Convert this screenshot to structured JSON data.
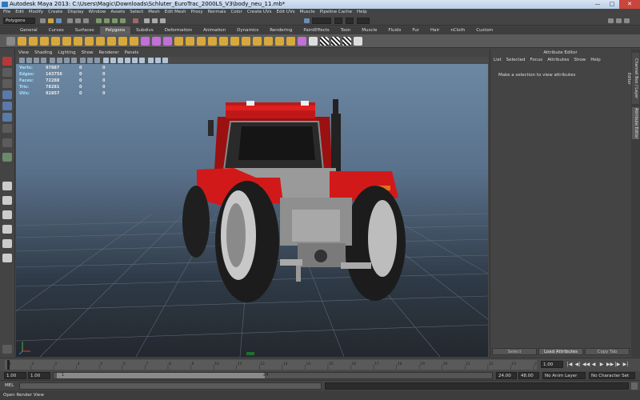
{
  "window": {
    "title": "Autodesk Maya 2013: C:\\Users\\Magic\\Downloads\\Schluter_EuroTrac_2000LS_V3\\body_neu_11.mb*"
  },
  "menubar": [
    "File",
    "Edit",
    "Modify",
    "Create",
    "Display",
    "Window",
    "Assets",
    "Select",
    "Mesh",
    "Edit Mesh",
    "Proxy",
    "Normals",
    "Color",
    "Create UVs",
    "Edit UVs",
    "Muscle",
    "Pipeline Cache",
    "Help"
  ],
  "statusline": {
    "mode": "Polygons"
  },
  "shelf_tabs": [
    "General",
    "Curves",
    "Surfaces",
    "Polygons",
    "Subdivs",
    "Deformation",
    "Animation",
    "Dynamics",
    "Rendering",
    "PaintEffects",
    "Toon",
    "Muscle",
    "Fluids",
    "Fur",
    "Hair",
    "nCloth",
    "Custom"
  ],
  "active_shelf_tab": "Polygons",
  "panel_menu": [
    "View",
    "Shading",
    "Lighting",
    "Show",
    "Renderer",
    "Panels"
  ],
  "hud": [
    {
      "label": "Verts:",
      "v1": "97887",
      "v2": "0",
      "v3": "0"
    },
    {
      "label": "Edges:",
      "v1": "143756",
      "v2": "0",
      "v3": "0"
    },
    {
      "label": "Faces:",
      "v1": "72288",
      "v2": "0",
      "v3": "0"
    },
    {
      "label": "Tris:",
      "v1": "78281",
      "v2": "0",
      "v3": "0"
    },
    {
      "label": "UVs:",
      "v1": "92857",
      "v2": "0",
      "v3": "0"
    }
  ],
  "attribute_editor": {
    "header": "Attribute Editor",
    "menu": [
      "List",
      "Selected",
      "Focus",
      "Attributes",
      "Show",
      "Help"
    ],
    "message": "Make a selection to view attributes",
    "buttons": [
      "Select",
      "Load Attributes",
      "Copy Tab"
    ]
  },
  "side_tabs": [
    "Channel Box / Layer Editor",
    "Attribute Editor"
  ],
  "timeslider": {
    "ticks": [
      "1",
      "2",
      "3",
      "4",
      "5",
      "6",
      "7",
      "8",
      "9",
      "10",
      "11",
      "12",
      "13",
      "14",
      "15",
      "16",
      "17",
      "18",
      "19",
      "20",
      "21",
      "22",
      "23",
      "24"
    ],
    "current_frame": "1.00"
  },
  "range": {
    "start": "1.00",
    "inner_start": "1.00",
    "slider_start": "1",
    "slider_end": "24",
    "inner_end": "24.00",
    "end": "48.00",
    "anim_layer": "No Anim Layer",
    "char_set": "No Character Set"
  },
  "cmdline": {
    "label": "MEL"
  },
  "helpline": {
    "text": "Open Render View"
  }
}
